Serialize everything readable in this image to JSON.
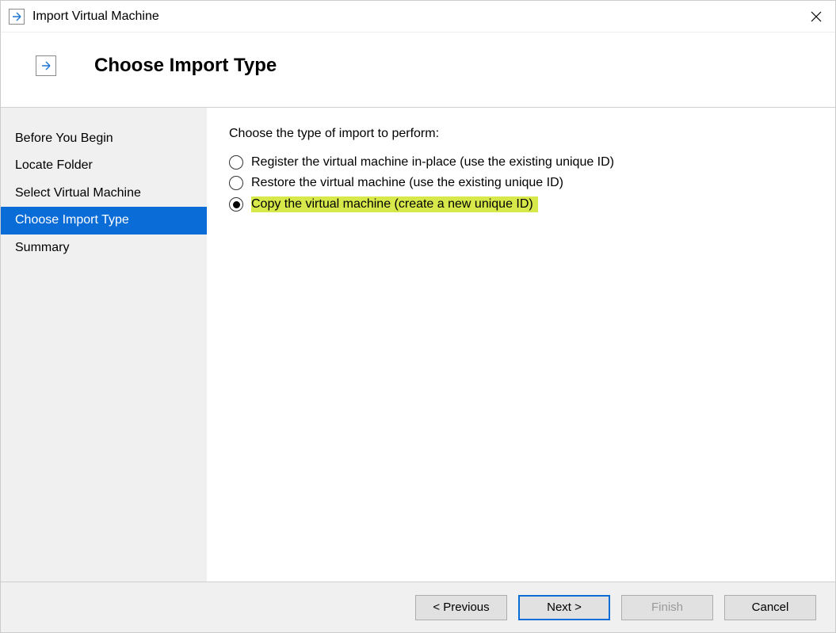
{
  "window": {
    "title": "Import Virtual Machine"
  },
  "header": {
    "title": "Choose Import Type"
  },
  "sidebar": {
    "steps": [
      {
        "label": "Before You Begin",
        "active": false
      },
      {
        "label": "Locate Folder",
        "active": false
      },
      {
        "label": "Select Virtual Machine",
        "active": false
      },
      {
        "label": "Choose Import Type",
        "active": true
      },
      {
        "label": "Summary",
        "active": false
      }
    ]
  },
  "content": {
    "prompt": "Choose the type of import to perform:",
    "options": [
      {
        "label": "Register the virtual machine in-place (use the existing unique ID)",
        "checked": false,
        "highlight": false
      },
      {
        "label": "Restore the virtual machine (use the existing unique ID)",
        "checked": false,
        "highlight": false
      },
      {
        "label": "Copy the virtual machine (create a new unique ID)",
        "checked": true,
        "highlight": true
      }
    ]
  },
  "footer": {
    "previous": "< Previous",
    "next": "Next >",
    "finish": "Finish",
    "cancel": "Cancel"
  }
}
